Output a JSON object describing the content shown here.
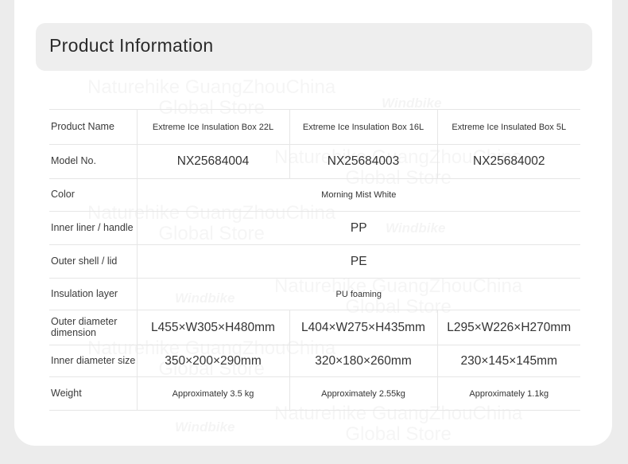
{
  "header": {
    "title": "Product Information"
  },
  "watermarks": {
    "text": [
      "Naturehike GuangZhouChina",
      "Global Store"
    ],
    "logo": "Windbike"
  },
  "table": {
    "rows": [
      {
        "label": "Product Name",
        "cells": [
          "Extreme Ice Insulation Box 22L",
          "Extreme Ice Insulation Box 16L",
          "Extreme Ice Insulated Box 5L"
        ]
      },
      {
        "label": "Model No.",
        "cells": [
          "NX25684004",
          "NX25684003",
          "NX25684002"
        ]
      },
      {
        "label": "Color",
        "cells": [
          "Morning Mist White"
        ]
      },
      {
        "label": "Inner liner / handle",
        "cells": [
          "PP"
        ]
      },
      {
        "label": "Outer shell / lid",
        "cells": [
          "PE"
        ]
      },
      {
        "label": "Insulation layer",
        "cells": [
          "PU foaming"
        ]
      },
      {
        "label": "Outer diameter dimension",
        "cells": [
          "L455×W305×H480mm",
          "L404×W275×H435mm",
          "L295×W226×H270mm"
        ]
      },
      {
        "label": "Inner diameter size",
        "cells": [
          "350×200×290mm",
          "320×180×260mm",
          "230×145×145mm"
        ]
      },
      {
        "label": "Weight",
        "cells": [
          "Approximately 3.5 kg",
          "Approximately 2.55kg",
          "Approximately 1.1kg"
        ]
      }
    ]
  }
}
